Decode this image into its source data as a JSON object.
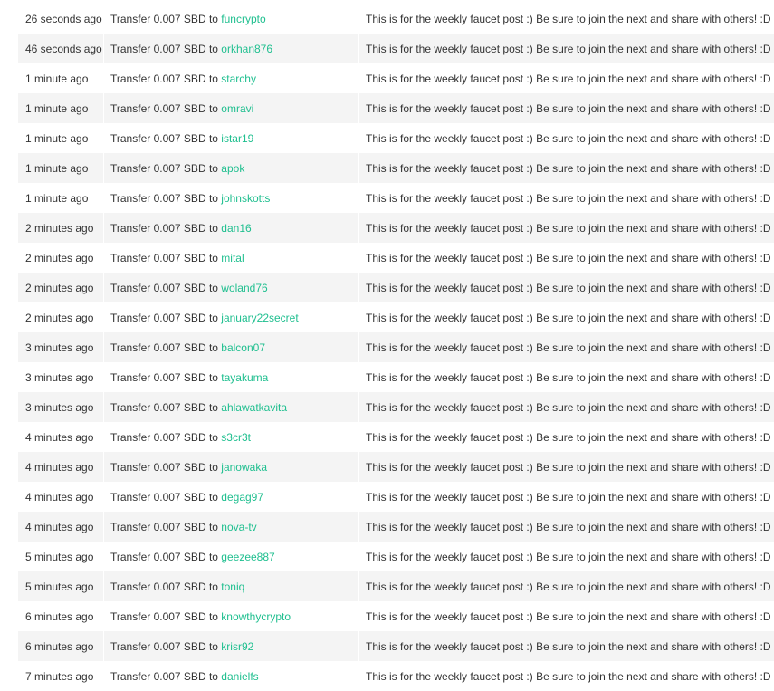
{
  "history": {
    "transfer_prefix": "Transfer 0.007 SBD to",
    "rows": [
      {
        "time": "26 seconds ago",
        "recipient": "funcrypto",
        "memo": "This is for the weekly faucet post :) Be sure to join the next and share with others! :D"
      },
      {
        "time": "46 seconds ago",
        "recipient": "orkhan876",
        "memo": "This is for the weekly faucet post :) Be sure to join the next and share with others! :D"
      },
      {
        "time": "1 minute ago",
        "recipient": "starchy",
        "memo": "This is for the weekly faucet post :) Be sure to join the next and share with others! :D"
      },
      {
        "time": "1 minute ago",
        "recipient": "omravi",
        "memo": "This is for the weekly faucet post :) Be sure to join the next and share with others! :D"
      },
      {
        "time": "1 minute ago",
        "recipient": "istar19",
        "memo": "This is for the weekly faucet post :) Be sure to join the next and share with others! :D"
      },
      {
        "time": "1 minute ago",
        "recipient": "apok",
        "memo": "This is for the weekly faucet post :) Be sure to join the next and share with others! :D"
      },
      {
        "time": "1 minute ago",
        "recipient": "johnskotts",
        "memo": "This is for the weekly faucet post :) Be sure to join the next and share with others! :D"
      },
      {
        "time": "2 minutes ago",
        "recipient": "dan16",
        "memo": "This is for the weekly faucet post :) Be sure to join the next and share with others! :D"
      },
      {
        "time": "2 minutes ago",
        "recipient": "mital",
        "memo": "This is for the weekly faucet post :) Be sure to join the next and share with others! :D"
      },
      {
        "time": "2 minutes ago",
        "recipient": "woland76",
        "memo": "This is for the weekly faucet post :) Be sure to join the next and share with others! :D"
      },
      {
        "time": "2 minutes ago",
        "recipient": "january22secret",
        "memo": "This is for the weekly faucet post :) Be sure to join the next and share with others! :D"
      },
      {
        "time": "3 minutes ago",
        "recipient": "balcon07",
        "memo": "This is for the weekly faucet post :) Be sure to join the next and share with others! :D"
      },
      {
        "time": "3 minutes ago",
        "recipient": "tayakuma",
        "memo": "This is for the weekly faucet post :) Be sure to join the next and share with others! :D"
      },
      {
        "time": "3 minutes ago",
        "recipient": "ahlawatkavita",
        "memo": "This is for the weekly faucet post :) Be sure to join the next and share with others! :D"
      },
      {
        "time": "4 minutes ago",
        "recipient": "s3cr3t",
        "memo": "This is for the weekly faucet post :) Be sure to join the next and share with others! :D"
      },
      {
        "time": "4 minutes ago",
        "recipient": "janowaka",
        "memo": "This is for the weekly faucet post :) Be sure to join the next and share with others! :D"
      },
      {
        "time": "4 minutes ago",
        "recipient": "degag97",
        "memo": "This is for the weekly faucet post :) Be sure to join the next and share with others! :D"
      },
      {
        "time": "4 minutes ago",
        "recipient": "nova-tv",
        "memo": "This is for the weekly faucet post :) Be sure to join the next and share with others! :D"
      },
      {
        "time": "5 minutes ago",
        "recipient": "geezee887",
        "memo": "This is for the weekly faucet post :) Be sure to join the next and share with others! :D"
      },
      {
        "time": "5 minutes ago",
        "recipient": "toniq",
        "memo": "This is for the weekly faucet post :) Be sure to join the next and share with others! :D"
      },
      {
        "time": "6 minutes ago",
        "recipient": "knowthycrypto",
        "memo": "This is for the weekly faucet post :) Be sure to join the next and share with others! :D"
      },
      {
        "time": "6 minutes ago",
        "recipient": "krisr92",
        "memo": "This is for the weekly faucet post :) Be sure to join the next and share with others! :D"
      },
      {
        "time": "7 minutes ago",
        "recipient": "danielfs",
        "memo": "This is for the weekly faucet post :) Be sure to join the next and share with others! :D"
      }
    ]
  },
  "colors": {
    "link": "#1fbf8f",
    "row_shade": "#f4f4f4",
    "text": "#333333"
  }
}
